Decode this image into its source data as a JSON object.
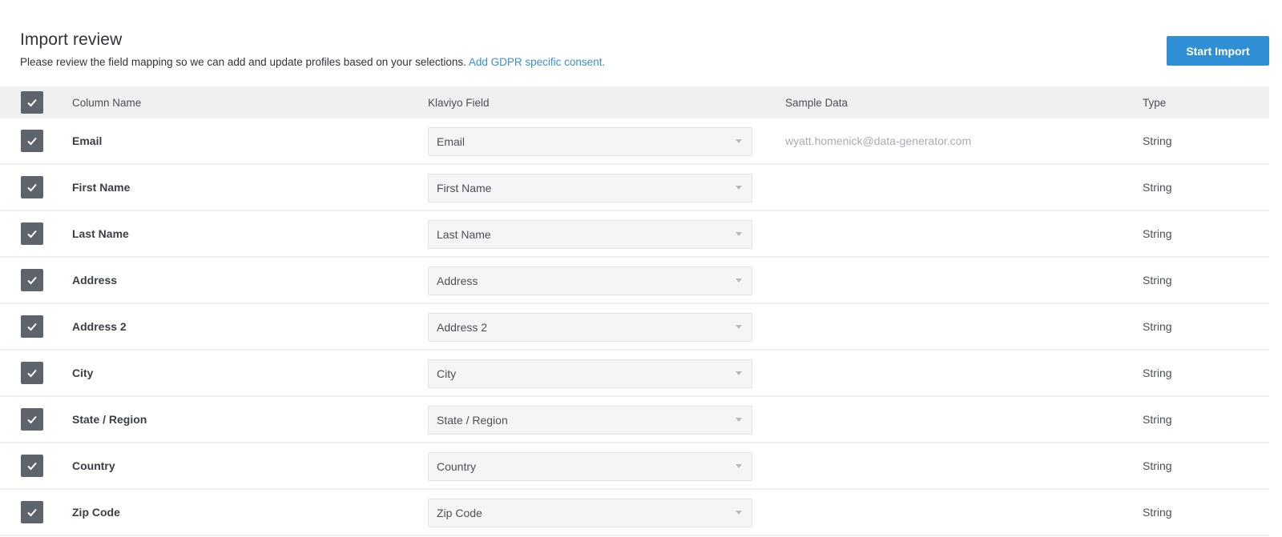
{
  "header": {
    "title": "Import review",
    "subtitle": "Please review the field mapping so we can add and update profiles based on your selections.",
    "gdpr_link": "Add GDPR specific consent."
  },
  "start_button": "Start Import",
  "columns": {
    "name": "Column Name",
    "field": "Klaviyo Field",
    "sample": "Sample Data",
    "type": "Type"
  },
  "rows": [
    {
      "name": "Email",
      "field": "Email",
      "sample": "wyatt.homenick@data-generator.com",
      "type": "String"
    },
    {
      "name": "First Name",
      "field": "First Name",
      "sample": "",
      "type": "String"
    },
    {
      "name": "Last Name",
      "field": "Last Name",
      "sample": "",
      "type": "String"
    },
    {
      "name": "Address",
      "field": "Address",
      "sample": "",
      "type": "String"
    },
    {
      "name": "Address 2",
      "field": "Address 2",
      "sample": "",
      "type": "String"
    },
    {
      "name": "City",
      "field": "City",
      "sample": "",
      "type": "String"
    },
    {
      "name": "State / Region",
      "field": "State / Region",
      "sample": "",
      "type": "String"
    },
    {
      "name": "Country",
      "field": "Country",
      "sample": "",
      "type": "String"
    },
    {
      "name": "Zip Code",
      "field": "Zip Code",
      "sample": "",
      "type": "String"
    }
  ],
  "colors": {
    "accent": "#2f8fd4",
    "link": "#3a8fcf",
    "checkbox": "#5d646c",
    "header_bg": "#eef0f2"
  }
}
